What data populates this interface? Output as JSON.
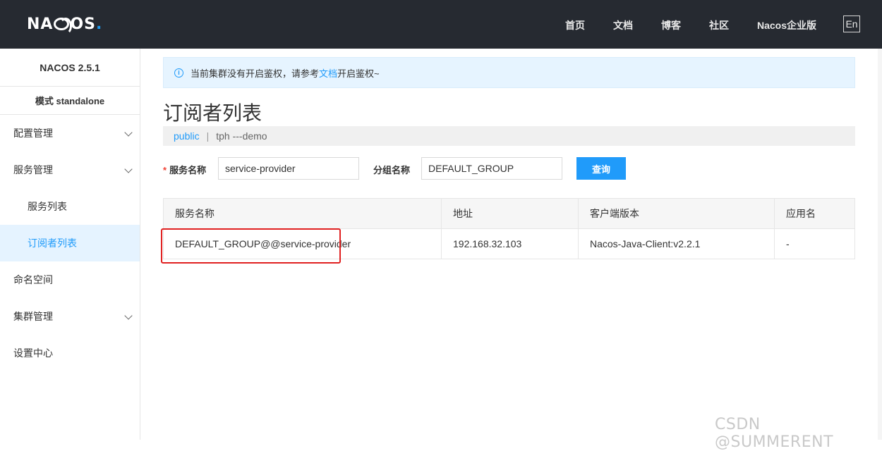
{
  "header": {
    "logo": "NACOS.",
    "nav": [
      "首页",
      "文档",
      "博客",
      "社区",
      "Nacos企业版"
    ],
    "lang": "En"
  },
  "sidebar": {
    "version": "NACOS 2.5.1",
    "mode": "模式 standalone",
    "items": [
      {
        "label": "配置管理",
        "expandable": true
      },
      {
        "label": "服务管理",
        "expandable": true
      },
      {
        "label": "服务列表",
        "sub": true
      },
      {
        "label": "订阅者列表",
        "sub": true,
        "active": true
      },
      {
        "label": "命名空间"
      },
      {
        "label": "集群管理",
        "expandable": true
      },
      {
        "label": "设置中心"
      }
    ]
  },
  "alert": {
    "text_before": "当前集群没有开启鉴权，请参考",
    "link": "文档",
    "text_after": "开启鉴权~"
  },
  "page_title": "订阅者列表",
  "breadcrumb": {
    "namespace": "public",
    "separator": "|",
    "detail": "tph ---demo"
  },
  "form": {
    "service_label": "服务名称",
    "service_value": "service-provider",
    "group_label": "分组名称",
    "group_value": "DEFAULT_GROUP",
    "query_button": "查询"
  },
  "table": {
    "headers": [
      "服务名称",
      "地址",
      "客户端版本",
      "应用名"
    ],
    "rows": [
      [
        "DEFAULT_GROUP@@service-provider",
        "192.168.32.103",
        "Nacos-Java-Client:v2.2.1",
        "-"
      ]
    ]
  },
  "watermark": "CSDN @SUMMERENT",
  "colors": {
    "accent": "#209bfa",
    "header_bg": "#262a31",
    "highlight_box": "#e02020"
  }
}
